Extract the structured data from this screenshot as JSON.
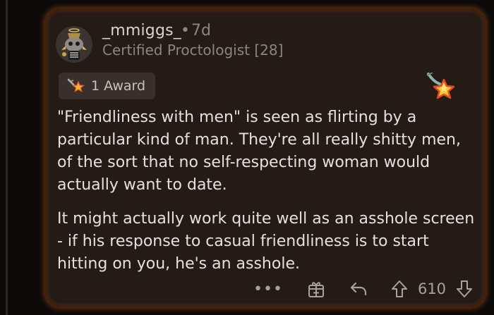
{
  "comment": {
    "username": "_mmiggs_",
    "separator": "•",
    "time_ago": "7d",
    "flair": "Certified Proctologist [28]",
    "award": {
      "count_label": "1 Award",
      "icon": "award-star-icon"
    },
    "corner_award_icon": "gold-star-award-icon",
    "paragraphs": [
      "\"Friendliness with men\" is seen as flirting by a particular kind of man. They're all really shitty men, of the sort that no self-respecting woman would actually want to date.",
      "It might actually work quite well as an asshole screen - if his response to casual friendliness is to start hitting on you, he's an asshole."
    ],
    "actions": {
      "more_label": "•••",
      "score": "610"
    },
    "colors": {
      "card_bg": "#241a16",
      "glow": "#6a3412",
      "text": "#e6e1dc",
      "muted": "#8c8580"
    }
  }
}
